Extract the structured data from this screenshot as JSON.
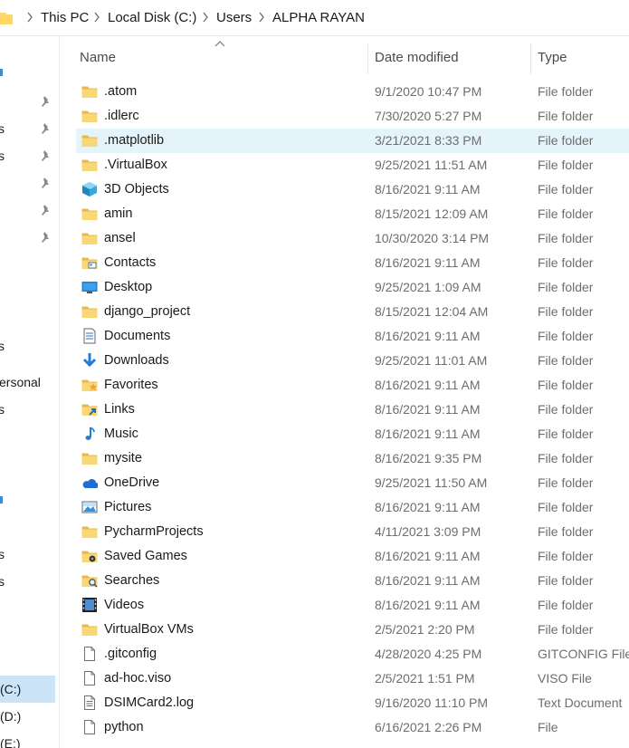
{
  "breadcrumb": {
    "segments": [
      "This PC",
      "Local Disk (C:)",
      "Users",
      "ALPHA RAYAN"
    ]
  },
  "nav": {
    "texts": [
      "s",
      "s",
      "s",
      "ersonal",
      "s",
      "s",
      "s"
    ],
    "drives": [
      "(C:)",
      "(D:)",
      "(E:)"
    ]
  },
  "columns": {
    "name": "Name",
    "date": "Date modified",
    "type": "Type"
  },
  "files": [
    {
      "name": ".atom",
      "date": "9/1/2020 10:47 PM",
      "type": "File folder",
      "icon": "folder-icon"
    },
    {
      "name": ".idlerc",
      "date": "7/30/2020 5:27 PM",
      "type": "File folder",
      "icon": "folder-icon"
    },
    {
      "name": ".matplotlib",
      "date": "3/21/2021 8:33 PM",
      "type": "File folder",
      "icon": "folder-icon",
      "selected": true
    },
    {
      "name": ".VirtualBox",
      "date": "9/25/2021 11:51 AM",
      "type": "File folder",
      "icon": "folder-icon"
    },
    {
      "name": "3D Objects",
      "date": "8/16/2021 9:11 AM",
      "type": "File folder",
      "icon": "3d-objects-icon"
    },
    {
      "name": "amin",
      "date": "8/15/2021 12:09 AM",
      "type": "File folder",
      "icon": "folder-icon"
    },
    {
      "name": "ansel",
      "date": "10/30/2020 3:14 PM",
      "type": "File folder",
      "icon": "folder-icon"
    },
    {
      "name": "Contacts",
      "date": "8/16/2021 9:11 AM",
      "type": "File folder",
      "icon": "contacts-icon"
    },
    {
      "name": "Desktop",
      "date": "9/25/2021 1:09 AM",
      "type": "File folder",
      "icon": "desktop-icon"
    },
    {
      "name": "django_project",
      "date": "8/15/2021 12:04 AM",
      "type": "File folder",
      "icon": "folder-icon"
    },
    {
      "name": "Documents",
      "date": "8/16/2021 9:11 AM",
      "type": "File folder",
      "icon": "documents-icon"
    },
    {
      "name": "Downloads",
      "date": "9/25/2021 11:01 AM",
      "type": "File folder",
      "icon": "downloads-icon"
    },
    {
      "name": "Favorites",
      "date": "8/16/2021 9:11 AM",
      "type": "File folder",
      "icon": "favorites-icon"
    },
    {
      "name": "Links",
      "date": "8/16/2021 9:11 AM",
      "type": "File folder",
      "icon": "links-icon"
    },
    {
      "name": "Music",
      "date": "8/16/2021 9:11 AM",
      "type": "File folder",
      "icon": "music-icon"
    },
    {
      "name": "mysite",
      "date": "8/16/2021 9:35 PM",
      "type": "File folder",
      "icon": "folder-icon"
    },
    {
      "name": "OneDrive",
      "date": "9/25/2021 11:50 AM",
      "type": "File folder",
      "icon": "onedrive-icon"
    },
    {
      "name": "Pictures",
      "date": "8/16/2021 9:11 AM",
      "type": "File folder",
      "icon": "pictures-icon"
    },
    {
      "name": "PycharmProjects",
      "date": "4/11/2021 3:09 PM",
      "type": "File folder",
      "icon": "folder-icon"
    },
    {
      "name": "Saved Games",
      "date": "8/16/2021 9:11 AM",
      "type": "File folder",
      "icon": "saved-games-icon"
    },
    {
      "name": "Searches",
      "date": "8/16/2021 9:11 AM",
      "type": "File folder",
      "icon": "searches-icon"
    },
    {
      "name": "Videos",
      "date": "8/16/2021 9:11 AM",
      "type": "File folder",
      "icon": "videos-icon"
    },
    {
      "name": "VirtualBox VMs",
      "date": "2/5/2021 2:20 PM",
      "type": "File folder",
      "icon": "folder-icon"
    },
    {
      "name": ".gitconfig",
      "date": "4/28/2020 4:25 PM",
      "type": "GITCONFIG File",
      "icon": "file-icon"
    },
    {
      "name": "ad-hoc.viso",
      "date": "2/5/2021 1:51 PM",
      "type": "VISO File",
      "icon": "file-icon"
    },
    {
      "name": "DSIMCard2.log",
      "date": "9/16/2020 11:10 PM",
      "type": "Text Document",
      "icon": "text-file-icon"
    },
    {
      "name": "python",
      "date": "6/16/2021 2:26 PM",
      "type": "File",
      "icon": "file-icon"
    }
  ],
  "colors": {
    "selection": "#e5f3fb",
    "folder": "#f8d775",
    "accent": "#0078d7",
    "secondary_text": "#6d6d6d"
  }
}
